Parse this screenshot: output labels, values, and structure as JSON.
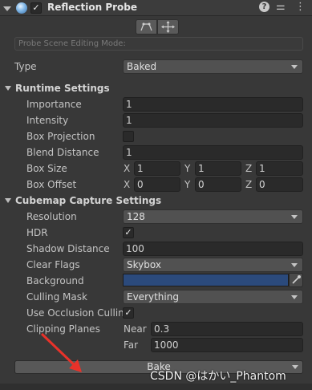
{
  "component": {
    "title": "Reflection Probe",
    "enabled": "✓",
    "help_icon": "?",
    "settings_icon": "⚌",
    "menu_icon": "⋮"
  },
  "editing_mode": {
    "placeholder": "Probe Scene Editing Mode:"
  },
  "type": {
    "label": "Type",
    "value": "Baked"
  },
  "runtime": {
    "header": "Runtime Settings",
    "importance_label": "Importance",
    "importance_value": "1",
    "intensity_label": "Intensity",
    "intensity_value": "1",
    "box_projection_label": "Box Projection",
    "blend_distance_label": "Blend Distance",
    "blend_distance_value": "1",
    "box_size_label": "Box Size",
    "box_size": {
      "x_label": "X",
      "x": "1",
      "y_label": "Y",
      "y": "1",
      "z_label": "Z",
      "z": "1"
    },
    "box_offset_label": "Box Offset",
    "box_offset": {
      "x_label": "X",
      "x": "0",
      "y_label": "Y",
      "y": "0",
      "z_label": "Z",
      "z": "0"
    }
  },
  "cubemap": {
    "header": "Cubemap Capture Settings",
    "resolution_label": "Resolution",
    "resolution_value": "128",
    "hdr_label": "HDR",
    "hdr_check": "✓",
    "shadow_distance_label": "Shadow Distance",
    "shadow_distance_value": "100",
    "clear_flags_label": "Clear Flags",
    "clear_flags_value": "Skybox",
    "background_label": "Background",
    "background_color": "#2b4a7c",
    "culling_mask_label": "Culling Mask",
    "culling_mask_value": "Everything",
    "occlusion_label": "Use Occlusion Culling",
    "occlusion_check": "✓",
    "clipping_label": "Clipping Planes",
    "near_label": "Near",
    "near_value": "0.3",
    "far_label": "Far",
    "far_value": "1000"
  },
  "bake_button": "Bake",
  "watermark": "CSDN @はかい_Phantom"
}
